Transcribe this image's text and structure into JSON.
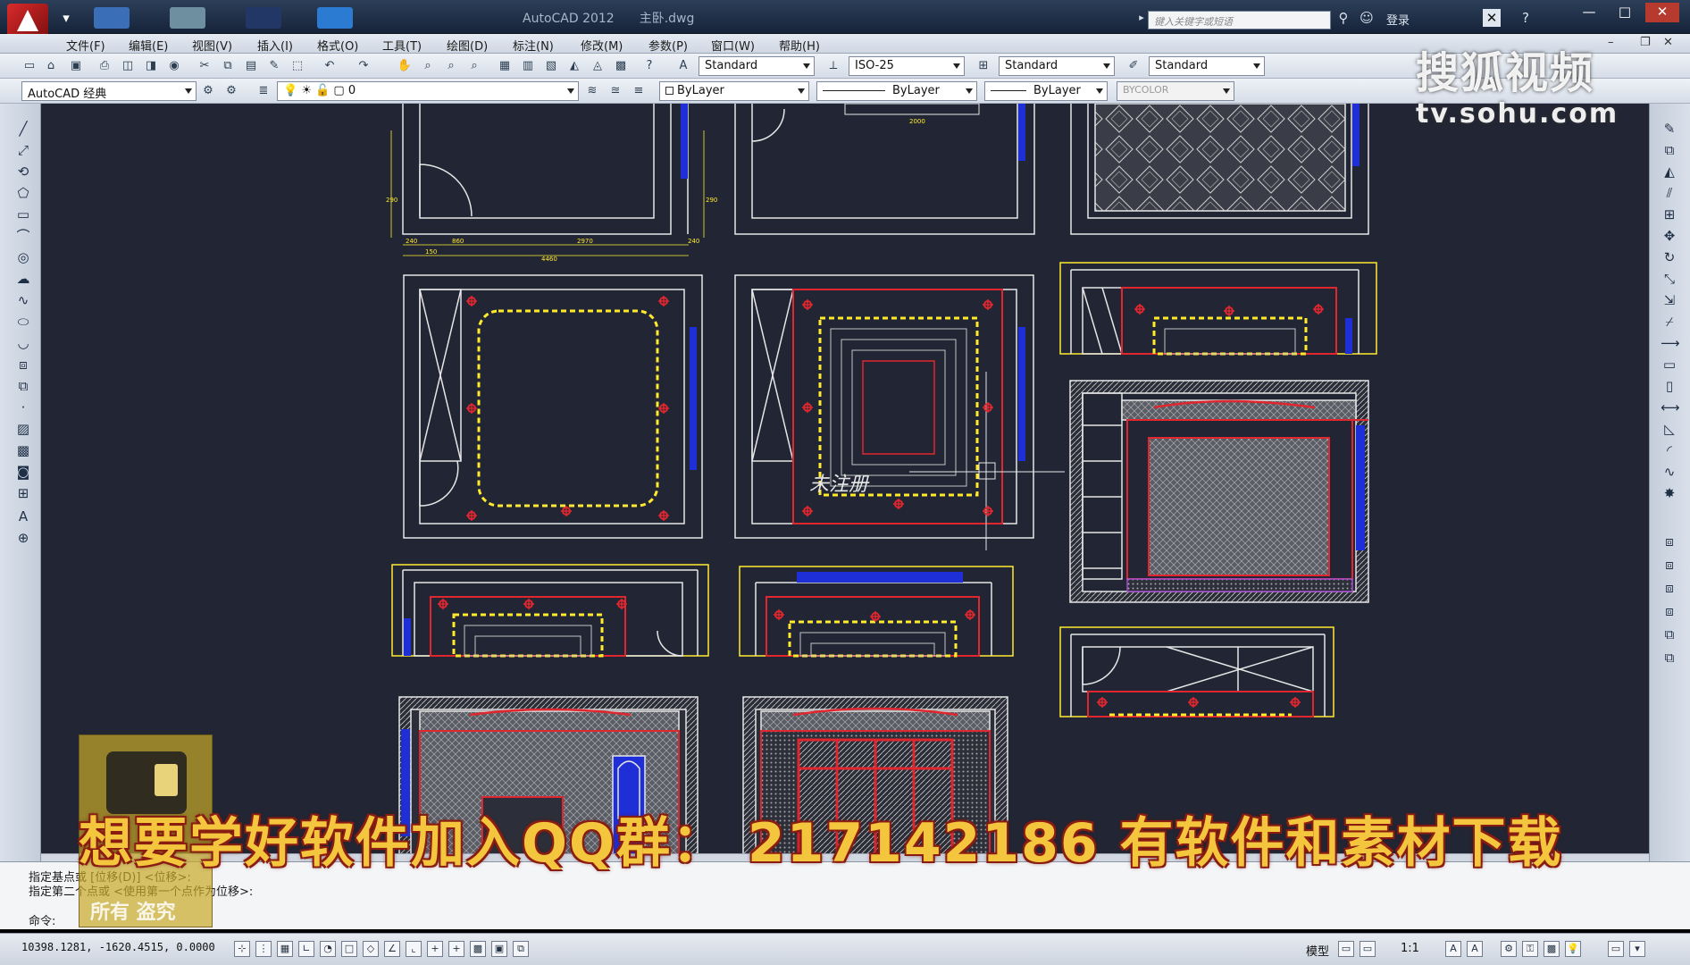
{
  "window": {
    "app_title": "AutoCAD 2012",
    "file_title": "主卧.dwg",
    "search_placeholder": "键入关键字或短语",
    "login_label": "登录"
  },
  "menu": {
    "items": [
      "文件(F)",
      "编辑(E)",
      "视图(V)",
      "插入(I)",
      "格式(O)",
      "工具(T)",
      "绘图(D)",
      "标注(N)",
      "修改(M)",
      "参数(P)",
      "窗口(W)",
      "帮助(H)"
    ]
  },
  "toolbar": {
    "text_style": "Standard",
    "dim_style": "ISO-25",
    "table_style": "Standard",
    "multileader_style": "Standard",
    "workspace": "AutoCAD 经典",
    "layer": "0",
    "color": "ByLayer",
    "linetype": "ByLayer",
    "lineweight": "ByLayer",
    "plotstyle": "BYCOLOR"
  },
  "drawing": {
    "annotation_text": "未注册",
    "dims": {
      "top_left": [
        "240",
        "860",
        "2970",
        "240",
        "150",
        "4460"
      ],
      "top_mid": "2000",
      "side_left": "290",
      "side_right": "290"
    }
  },
  "command": {
    "line1": "指定基点或 [位移(D)] <位移>:",
    "line2": "指定第二个点或 <使用第一个点作为位移>:",
    "prompt": "命令:"
  },
  "status": {
    "coords": "10398.1281,  -1620.4515,  0.0000",
    "model_label": "模型",
    "scale_label": "1:1"
  },
  "overlay": {
    "sohu_big": "搜狐视频",
    "sohu_small": "tv.sohu.com",
    "banner": "想要学好软件加入QQ群：  217142186  有软件和素材下载",
    "logo_caption": "所有  盗究"
  },
  "colors": {
    "canvas_bg": "#222634",
    "cad_white": "#e6e6e6",
    "cad_red": "#e0262e",
    "cad_yellow": "#ffea2e",
    "cad_blue": "#1f2fd8",
    "banner_text": "#f3c63d"
  }
}
